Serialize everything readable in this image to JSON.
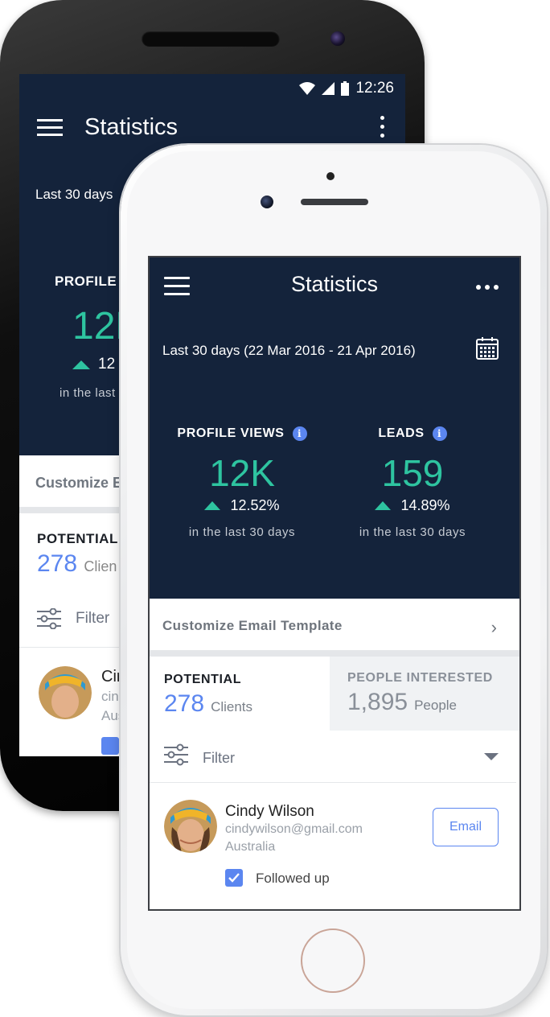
{
  "colors": {
    "navy": "#14233b",
    "teal": "#2ec4a0",
    "blue": "#5b86f0"
  },
  "android": {
    "status_time": "12:26",
    "title": "Statistics",
    "range": "Last 30 days",
    "profile_label": "PROFILE V",
    "big_value": "12K",
    "pct": "12",
    "last": "in the last",
    "customize": "Customize E",
    "potential_label": "POTENTIAL",
    "count": "278",
    "count_unit": "Clien",
    "filter": "Filter",
    "name": "Cir",
    "email": "cin",
    "country": "Aus"
  },
  "iphone": {
    "title": "Statistics",
    "range": "Last 30 days (22 Mar 2016 - 21 Apr 2016)",
    "stats": [
      {
        "label": "PROFILE VIEWS",
        "value": "12K",
        "pct": "12.52%",
        "period": "in the last 30 days"
      },
      {
        "label": "LEADS",
        "value": "159",
        "pct": "14.89%",
        "period": "in the last 30 days"
      }
    ],
    "info_glyph": "i",
    "customize": "Customize Email Template",
    "chevron": "›",
    "tabs": {
      "potential": {
        "label": "POTENTIAL",
        "count": "278",
        "unit": "Clients"
      },
      "interested": {
        "label": "PEOPLE INTERESTED",
        "count": "1,895",
        "unit": "People"
      }
    },
    "filter": "Filter",
    "contact": {
      "name": "Cindy Wilson",
      "email": "cindywilson@gmail.com",
      "country": "Australia",
      "action": "Email",
      "followed": "Followed up",
      "followed_checked": true
    }
  }
}
